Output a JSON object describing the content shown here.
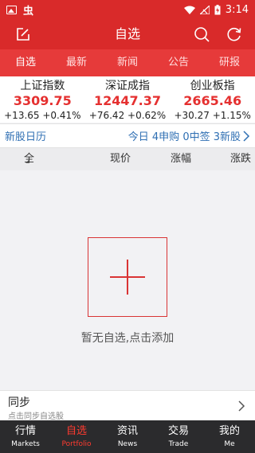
{
  "status_bar": {
    "app_glyph": "虫",
    "time": "3:14"
  },
  "app_bar": {
    "title": "自选",
    "edit_icon": "edit-icon",
    "search_icon": "search-icon",
    "refresh_icon": "refresh-icon"
  },
  "tabs": [
    {
      "label": "自选",
      "active": true
    },
    {
      "label": "最新",
      "active": false
    },
    {
      "label": "新闻",
      "active": false
    },
    {
      "label": "公告",
      "active": false
    },
    {
      "label": "研报",
      "active": false
    }
  ],
  "indices": [
    {
      "name": "上证指数",
      "value": "3309.75",
      "change": "+13.65 +0.41%"
    },
    {
      "name": "深证成指",
      "value": "12447.37",
      "change": "+76.42 +0.62%"
    },
    {
      "name": "创业板指",
      "value": "2665.46",
      "change": "+30.27 +1.15%"
    }
  ],
  "ipo_calendar": {
    "title": "新股日历",
    "summary": "今日 4申购 0中签 3新股"
  },
  "columns": {
    "all": "全部",
    "price": "现价",
    "change_pct": "涨幅",
    "change_amt": "涨跌"
  },
  "empty_state": {
    "message": "暂无自选,点击添加"
  },
  "sync": {
    "title": "同步",
    "subtitle": "点击同步自选股"
  },
  "bottom_nav": [
    {
      "cn": "行情",
      "en": "Markets",
      "active": false
    },
    {
      "cn": "自选",
      "en": "Portfolio",
      "active": true
    },
    {
      "cn": "资讯",
      "en": "News",
      "active": false
    },
    {
      "cn": "交易",
      "en": "Trade",
      "active": false
    },
    {
      "cn": "我的",
      "en": "Me",
      "active": false
    }
  ],
  "colors": {
    "brand_red": "#d92a2a",
    "up_red": "#e53030",
    "link_blue": "#2f6fb3",
    "nav_bg": "#2b2b2d"
  }
}
